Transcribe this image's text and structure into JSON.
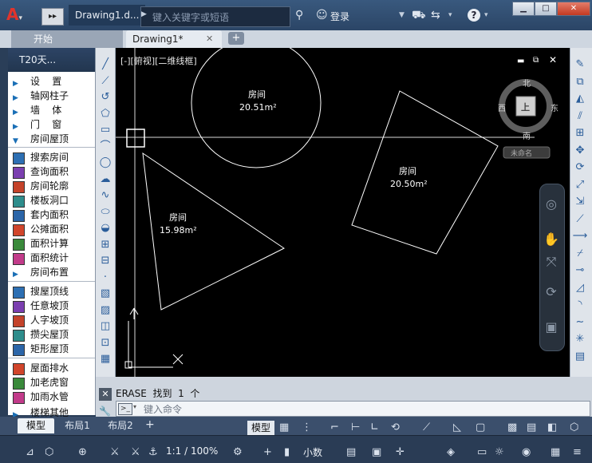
{
  "window": {
    "doc_title": "Drawing1.d...",
    "search_placeholder": "键入关键字或短语",
    "login": "登录",
    "min": "▁",
    "max": "□",
    "close": "✕"
  },
  "tabs": {
    "start": "开始",
    "drawing": "Drawing1*",
    "close": "✕",
    "plus": "+"
  },
  "palette": {
    "title": "T20天...",
    "items": [
      {
        "label": "设    置",
        "icon": "triangle-right-icon"
      },
      {
        "label": "轴网柱子",
        "icon": "triangle-right-icon"
      },
      {
        "label": "墙    体",
        "icon": "triangle-right-icon"
      },
      {
        "label": "门    窗",
        "icon": "triangle-right-icon"
      },
      {
        "label": "房间屋顶",
        "icon": "triangle-down-icon"
      },
      {
        "label": "搜索房间",
        "icon": "search-room-icon"
      },
      {
        "label": "查询面积",
        "icon": "query-area-icon"
      },
      {
        "label": "房间轮廓",
        "icon": "room-outline-icon"
      },
      {
        "label": "楼板洞口",
        "icon": "floor-opening-icon"
      },
      {
        "label": "套内面积",
        "icon": "inner-area-icon"
      },
      {
        "label": "公摊面积",
        "icon": "shared-area-icon"
      },
      {
        "label": "面积计算",
        "icon": "area-calc-icon"
      },
      {
        "label": "面积统计",
        "icon": "area-stats-icon"
      },
      {
        "label": "房间布置",
        "icon": "triangle-right-icon"
      },
      {
        "label": "搜屋顶线",
        "icon": "roof-line-icon"
      },
      {
        "label": "任意坡顶",
        "icon": "slope-roof-icon"
      },
      {
        "label": "人字坡顶",
        "icon": "gable-roof-icon"
      },
      {
        "label": "攒尖屋顶",
        "icon": "pyramid-roof-icon"
      },
      {
        "label": "矩形屋顶",
        "icon": "rect-roof-icon"
      },
      {
        "label": "屋面排水",
        "icon": "roof-drain-icon"
      },
      {
        "label": "加老虎窗",
        "icon": "dormer-icon"
      },
      {
        "label": "加雨水管",
        "icon": "downpipe-icon"
      },
      {
        "label": "楼梯其他",
        "icon": "triangle-right-icon"
      }
    ]
  },
  "viewport": {
    "label": "[-][俯视][二维线框]",
    "compass": {
      "n": "北",
      "s": "南",
      "e": "东",
      "w": "西",
      "top": "上"
    },
    "ucs_name": "未命名"
  },
  "rooms": [
    {
      "name": "房间",
      "area": "20.51m²"
    },
    {
      "name": "房间",
      "area": "20.50m²"
    },
    {
      "name": "房间",
      "area": "15.98m²"
    }
  ],
  "command": {
    "history": "ERASE  找到  1  个",
    "placeholder": "键入命令"
  },
  "layout_tabs": {
    "model": "模型",
    "layout1": "布局1",
    "layout2": "布局2",
    "plus": "+"
  },
  "status": {
    "model": "模型",
    "scale": "1:1 / 100%",
    "units": "小数"
  }
}
